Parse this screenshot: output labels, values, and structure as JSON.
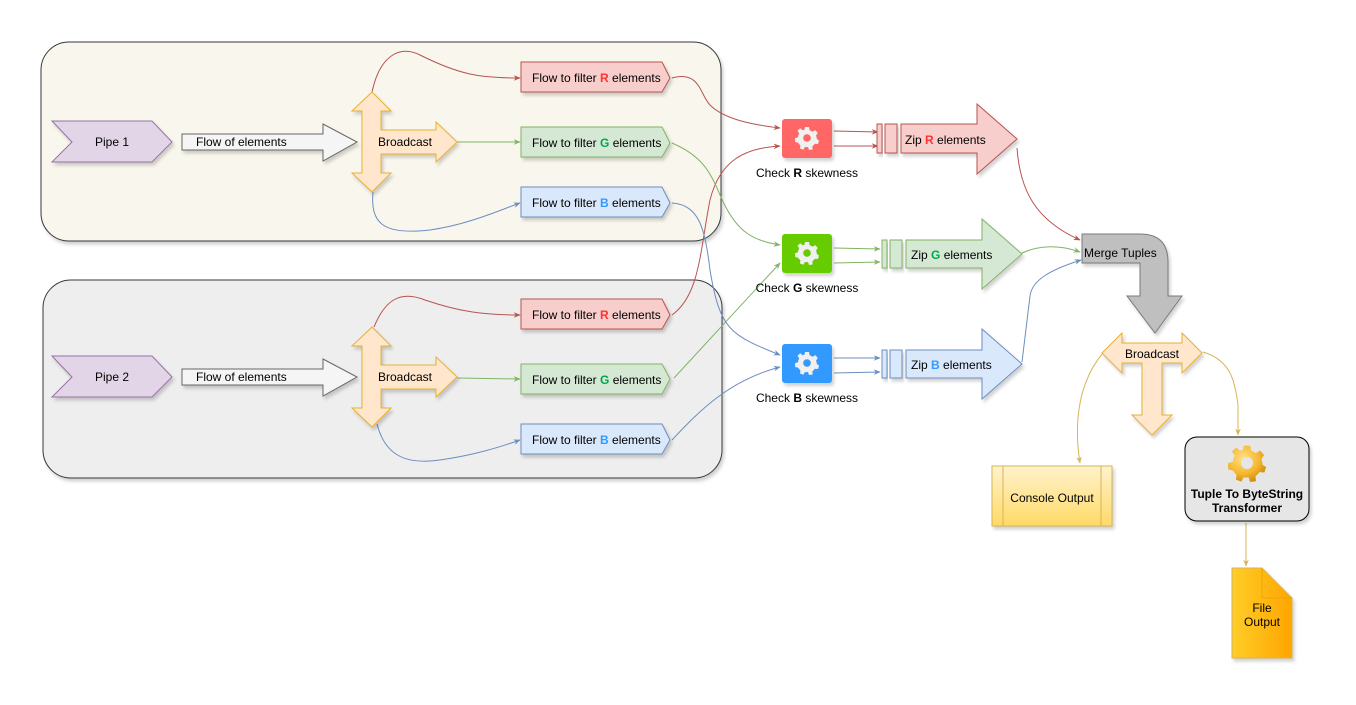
{
  "groups": [
    {
      "id": "pipe1",
      "pipe_label": "Pipe 1",
      "flow_label": "Flow of elements",
      "broadcast_label": "Broadcast",
      "filters": [
        {
          "prefix": "Flow to filter ",
          "channel": "R",
          "suffix": " elements"
        },
        {
          "prefix": "Flow to filter ",
          "channel": "G",
          "suffix": " elements"
        },
        {
          "prefix": "Flow to filter ",
          "channel": "B",
          "suffix": " elements"
        }
      ]
    },
    {
      "id": "pipe2",
      "pipe_label": "Pipe 2",
      "flow_label": "Flow of elements",
      "broadcast_label": "Broadcast",
      "filters": [
        {
          "prefix": "Flow to filter ",
          "channel": "R",
          "suffix": " elements"
        },
        {
          "prefix": "Flow to filter ",
          "channel": "G",
          "suffix": " elements"
        },
        {
          "prefix": "Flow to filter ",
          "channel": "B",
          "suffix": " elements"
        }
      ]
    }
  ],
  "checks": [
    {
      "prefix": "Check ",
      "channel": "R",
      "suffix": " skewness"
    },
    {
      "prefix": "Check ",
      "channel": "G",
      "suffix": " skewness"
    },
    {
      "prefix": "Check ",
      "channel": "B",
      "suffix": " skewness"
    }
  ],
  "zips": [
    {
      "prefix": "Zip ",
      "channel": "R",
      "suffix": " elements"
    },
    {
      "prefix": "Zip ",
      "channel": "G",
      "suffix": " elements"
    },
    {
      "prefix": "Zip ",
      "channel": "B",
      "suffix": " elements"
    }
  ],
  "merge_label": "Merge Tuples",
  "final_broadcast_label": "Broadcast",
  "console_label": "Console Output",
  "transformer": {
    "line1": "Tuple To ByteString",
    "line2": "Transformer"
  },
  "file_output": {
    "line1": "File",
    "line2": "Output"
  },
  "colors": {
    "R": "#ff3333",
    "G": "#00a651",
    "B": "#3399ff",
    "check_R": "#ff6666",
    "check_G": "#66cc00",
    "check_B": "#3399ff",
    "edge_R": "#b85450",
    "edge_G": "#82b366",
    "edge_B": "#6c8ebf",
    "edge_Y": "#d6b656",
    "transformer_text": "#999900"
  }
}
